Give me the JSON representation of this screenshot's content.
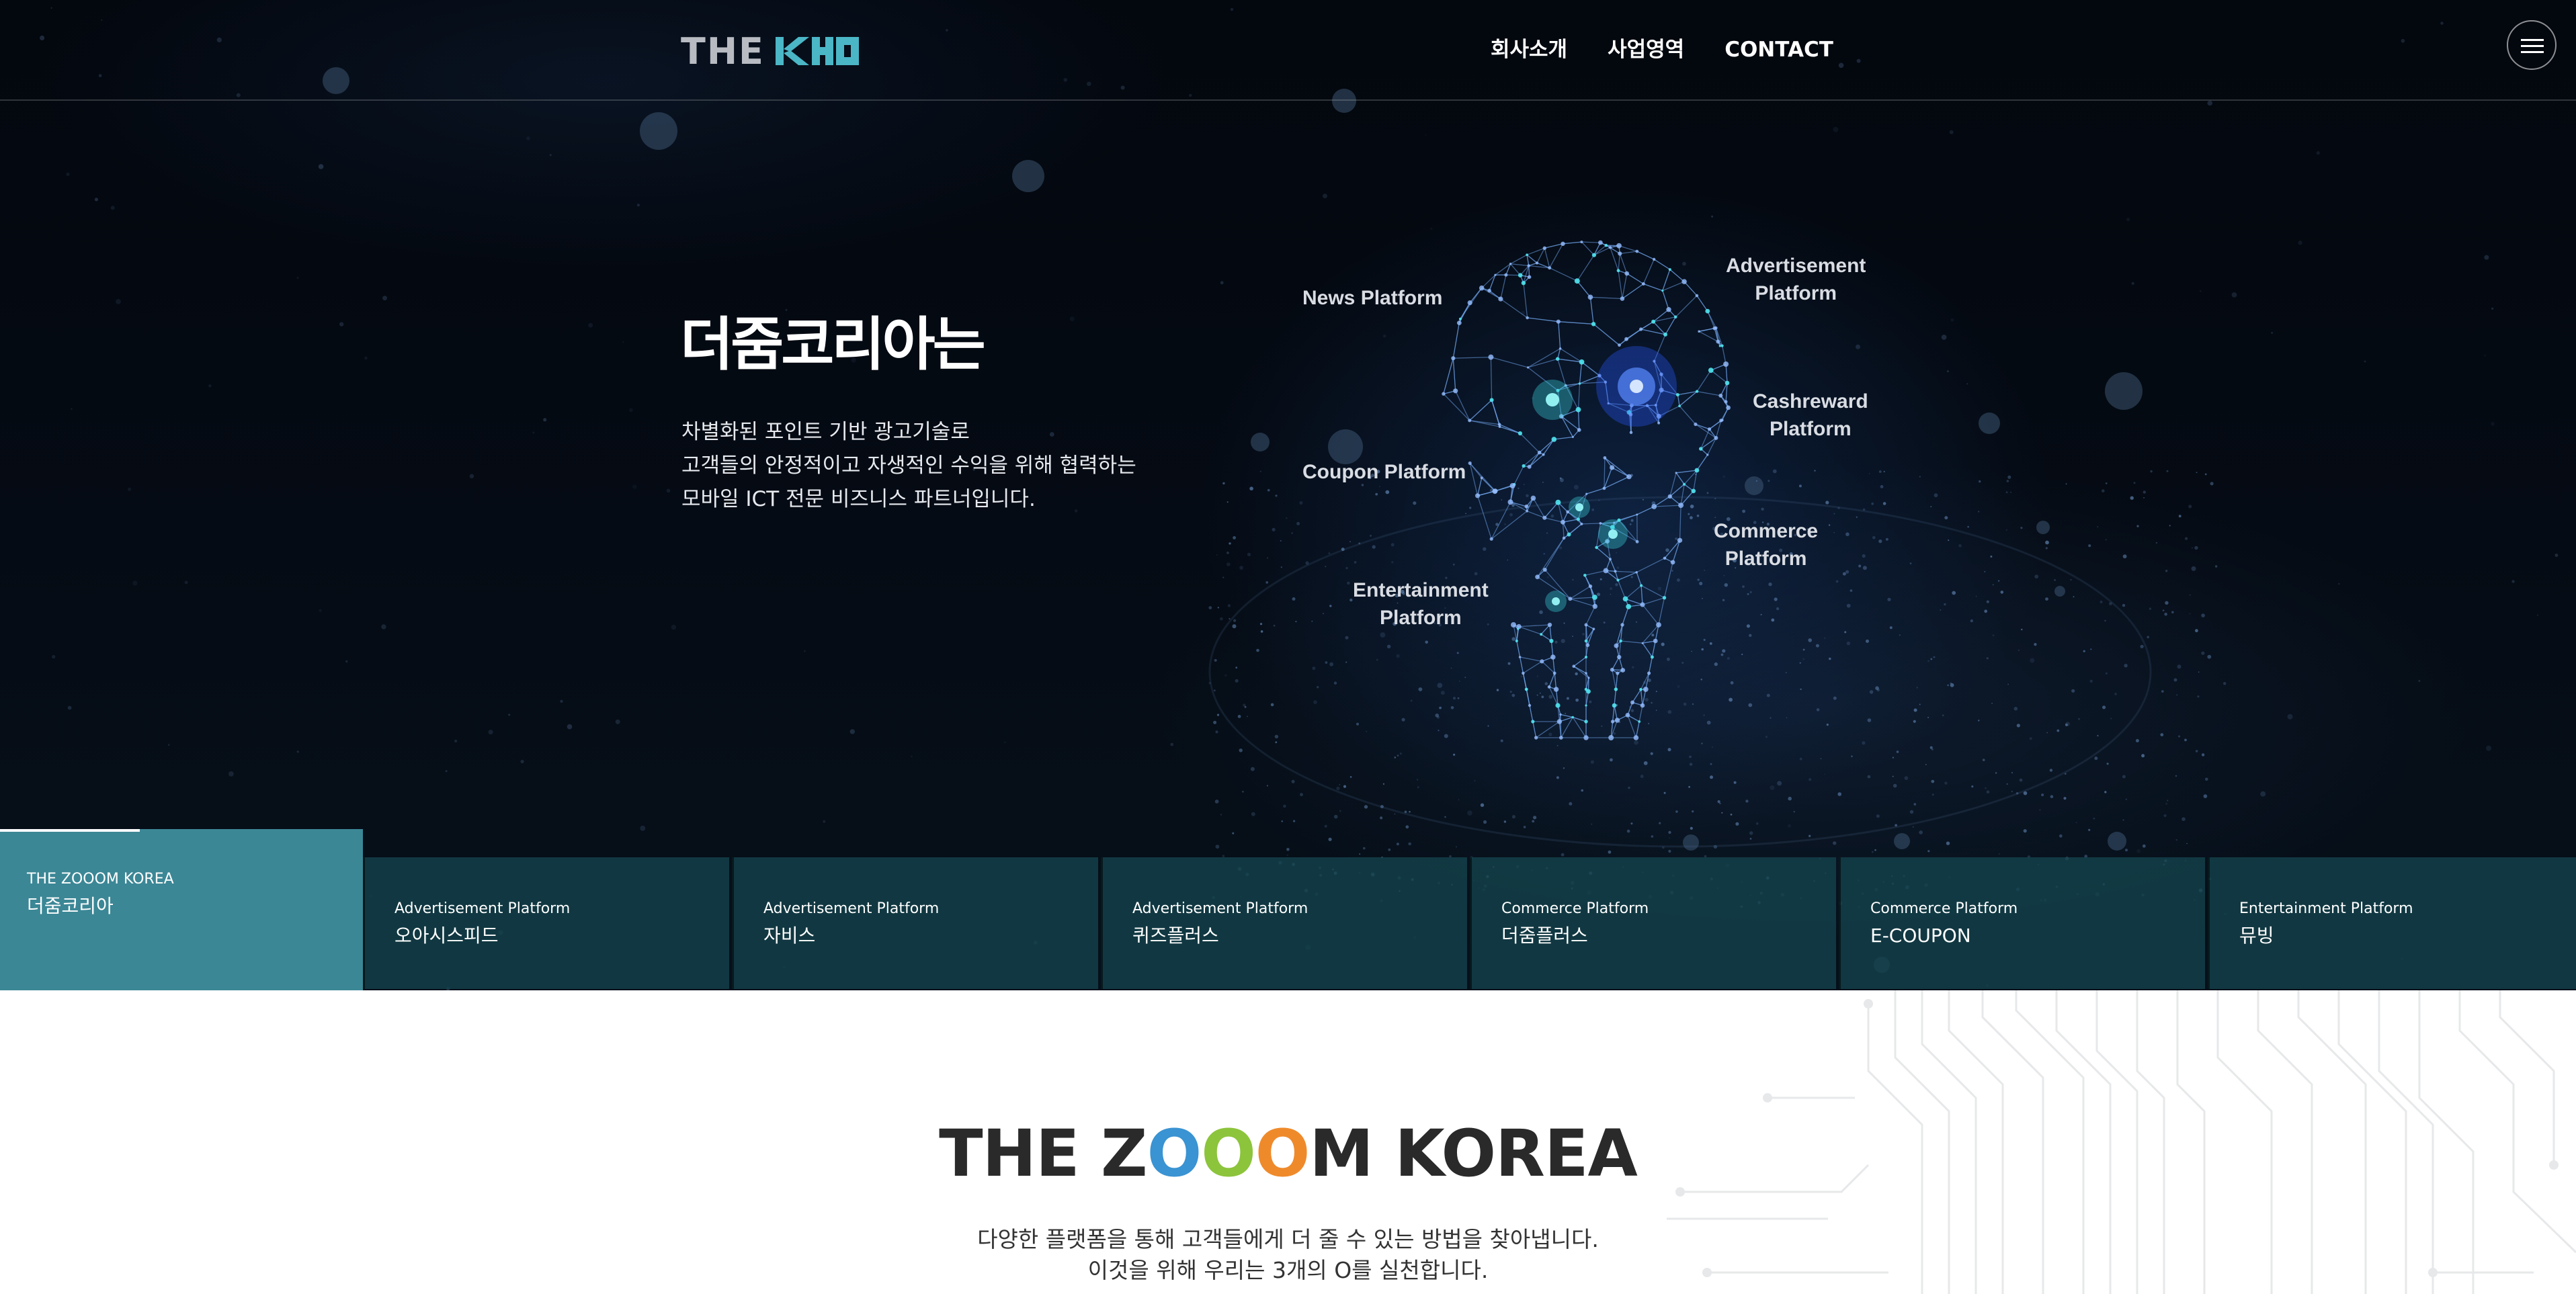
{
  "header": {
    "logo_text": "THE",
    "logo_mark_text": "KHO",
    "nav": [
      {
        "label": "회사소개"
      },
      {
        "label": "사업영역"
      },
      {
        "label": "CONTACT"
      }
    ]
  },
  "hero": {
    "title": "더줌코리아는",
    "description_lines": [
      "차별화된 포인트 기반 광고기술로",
      "고객들의 안정적이고 자생적인 수익을 위해 협력하는",
      "모바일 ICT 전문 비즈니스 파트너입니다."
    ],
    "platform_labels": {
      "news": "News Platform",
      "advertisement": [
        "Advertisement",
        "Platform"
      ],
      "cashreward": [
        "Cashreward",
        "Platform"
      ],
      "coupon": "Coupon Platform",
      "commerce": [
        "Commerce",
        "Platform"
      ],
      "entertainment": [
        "Entertainment",
        "Platform"
      ]
    }
  },
  "tabs": [
    {
      "category": "THE ZOOOM KOREA",
      "name": "더줌코리아",
      "active": true
    },
    {
      "category": "Advertisement Platform",
      "name": "오아시스피드"
    },
    {
      "category": "Advertisement Platform",
      "name": "자비스"
    },
    {
      "category": "Advertisement Platform",
      "name": "퀴즈플러스"
    },
    {
      "category": "Commerce Platform",
      "name": "더줌플러스"
    },
    {
      "category": "Commerce Platform",
      "name": "E-COUPON"
    },
    {
      "category": "Entertainment Platform",
      "name": "뮤빙"
    }
  ],
  "section": {
    "title_parts": [
      {
        "text": "THE Z",
        "color": "#2a2a2a"
      },
      {
        "text": "O",
        "color": "#3a93d2"
      },
      {
        "text": "O",
        "color": "#8cc43c"
      },
      {
        "text": "O",
        "color": "#ef8a2b"
      },
      {
        "text": "M KOREA",
        "color": "#2a2a2a"
      }
    ],
    "description_lines": [
      "다양한 플랫폼을 통해 고객들에게 더 줄 수 있는 방법을 찾아냅니다.",
      "이것을 위해 우리는 3개의 O를 실천합니다."
    ]
  },
  "colors": {
    "accent_teal": "#3b8796",
    "logo_teal": "#4bb6c6",
    "tab_bg": "#14424c",
    "hero_bg": "#050b14"
  }
}
